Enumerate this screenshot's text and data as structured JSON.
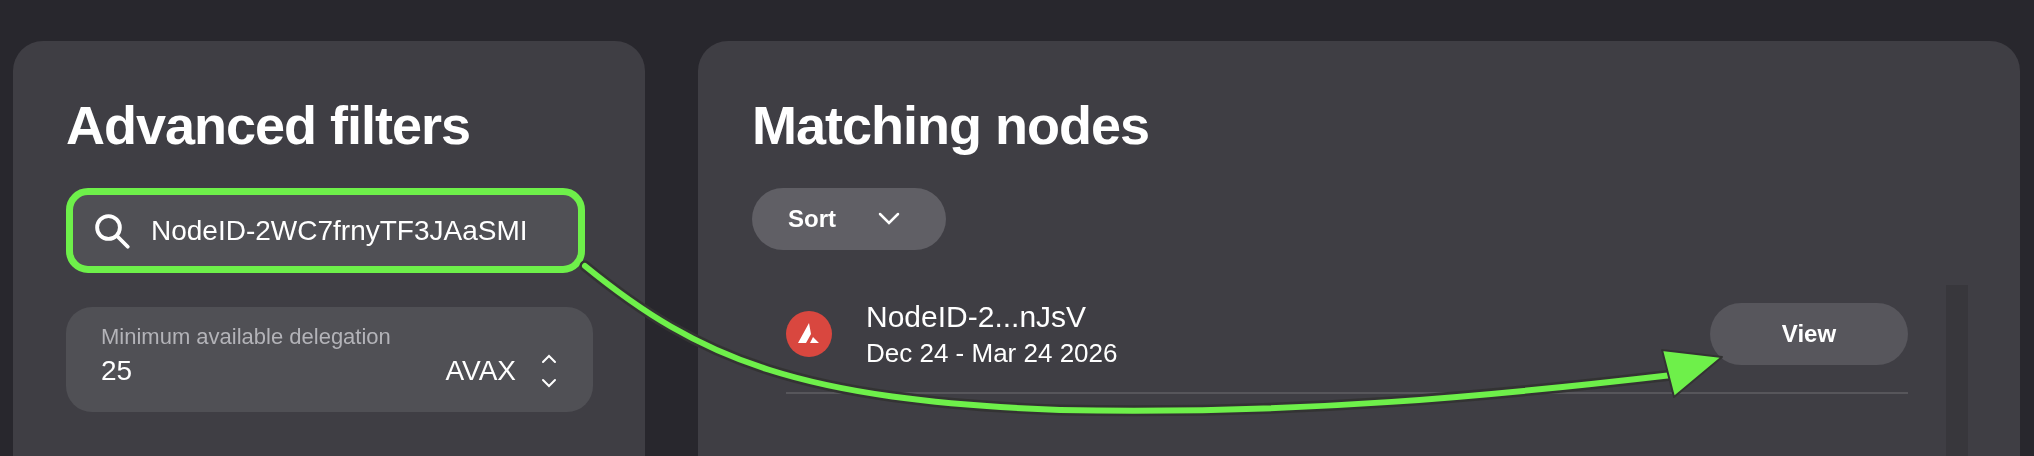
{
  "filters": {
    "title": "Advanced filters",
    "search": {
      "value": "NodeID-2WC7frnyTF3JAaSMI",
      "highlighted": true
    },
    "delegation": {
      "label": "Minimum available delegation",
      "value": "25",
      "unit": "AVAX"
    }
  },
  "results": {
    "title": "Matching nodes",
    "sort_label": "Sort",
    "nodes": [
      {
        "id": "NodeID-2...nJsV",
        "period": "Dec 24 - Mar 24 2026",
        "action": "View"
      }
    ]
  },
  "annotation": {
    "kind": "arrow"
  }
}
